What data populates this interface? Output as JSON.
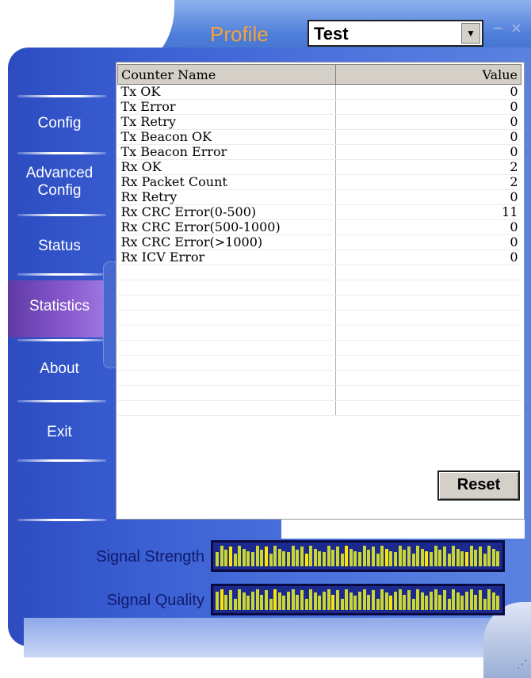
{
  "header": {
    "profile_label": "Profile",
    "profile_value": "Test",
    "minimize_glyph": "−",
    "close_glyph": "×"
  },
  "sidebar": {
    "items": [
      {
        "label": "Config"
      },
      {
        "label": "Advanced Config",
        "line1": "Advanced",
        "line2": "Config"
      },
      {
        "label": "Status"
      },
      {
        "label": "Statistics",
        "active": true
      },
      {
        "label": "About"
      },
      {
        "label": "Exit"
      }
    ]
  },
  "statistics": {
    "columns": [
      "Counter Name",
      "Value"
    ],
    "rows": [
      {
        "name": "Tx OK",
        "value": "0"
      },
      {
        "name": "Tx Error",
        "value": "0"
      },
      {
        "name": "Tx Retry",
        "value": "0"
      },
      {
        "name": "Tx Beacon OK",
        "value": "0"
      },
      {
        "name": "Tx Beacon Error",
        "value": "0"
      },
      {
        "name": "Rx OK",
        "value": "2"
      },
      {
        "name": "Rx Packet Count",
        "value": "2"
      },
      {
        "name": "Rx Retry",
        "value": "0"
      },
      {
        "name": "Rx CRC Error(0-500)",
        "value": "11"
      },
      {
        "name": "Rx CRC Error(500-1000)",
        "value": "0"
      },
      {
        "name": "Rx CRC Error(>1000)",
        "value": "0"
      },
      {
        "name": "Rx ICV Error",
        "value": "0"
      }
    ],
    "empty_rows": 10,
    "reset_label": "Reset"
  },
  "signal": {
    "strength_label": "Signal Strength",
    "quality_label": "Signal Quality",
    "strength_bars": 64,
    "quality_bars": 64,
    "colors": {
      "meter_bg": "#1b2a8c",
      "bar": "#c9d633",
      "bar_highlight": "#ffe500"
    }
  },
  "colors": {
    "profile_label": "#f2a33b",
    "sidebar_bg": "#2c4cc0",
    "active_item": "#8a5bd0"
  }
}
